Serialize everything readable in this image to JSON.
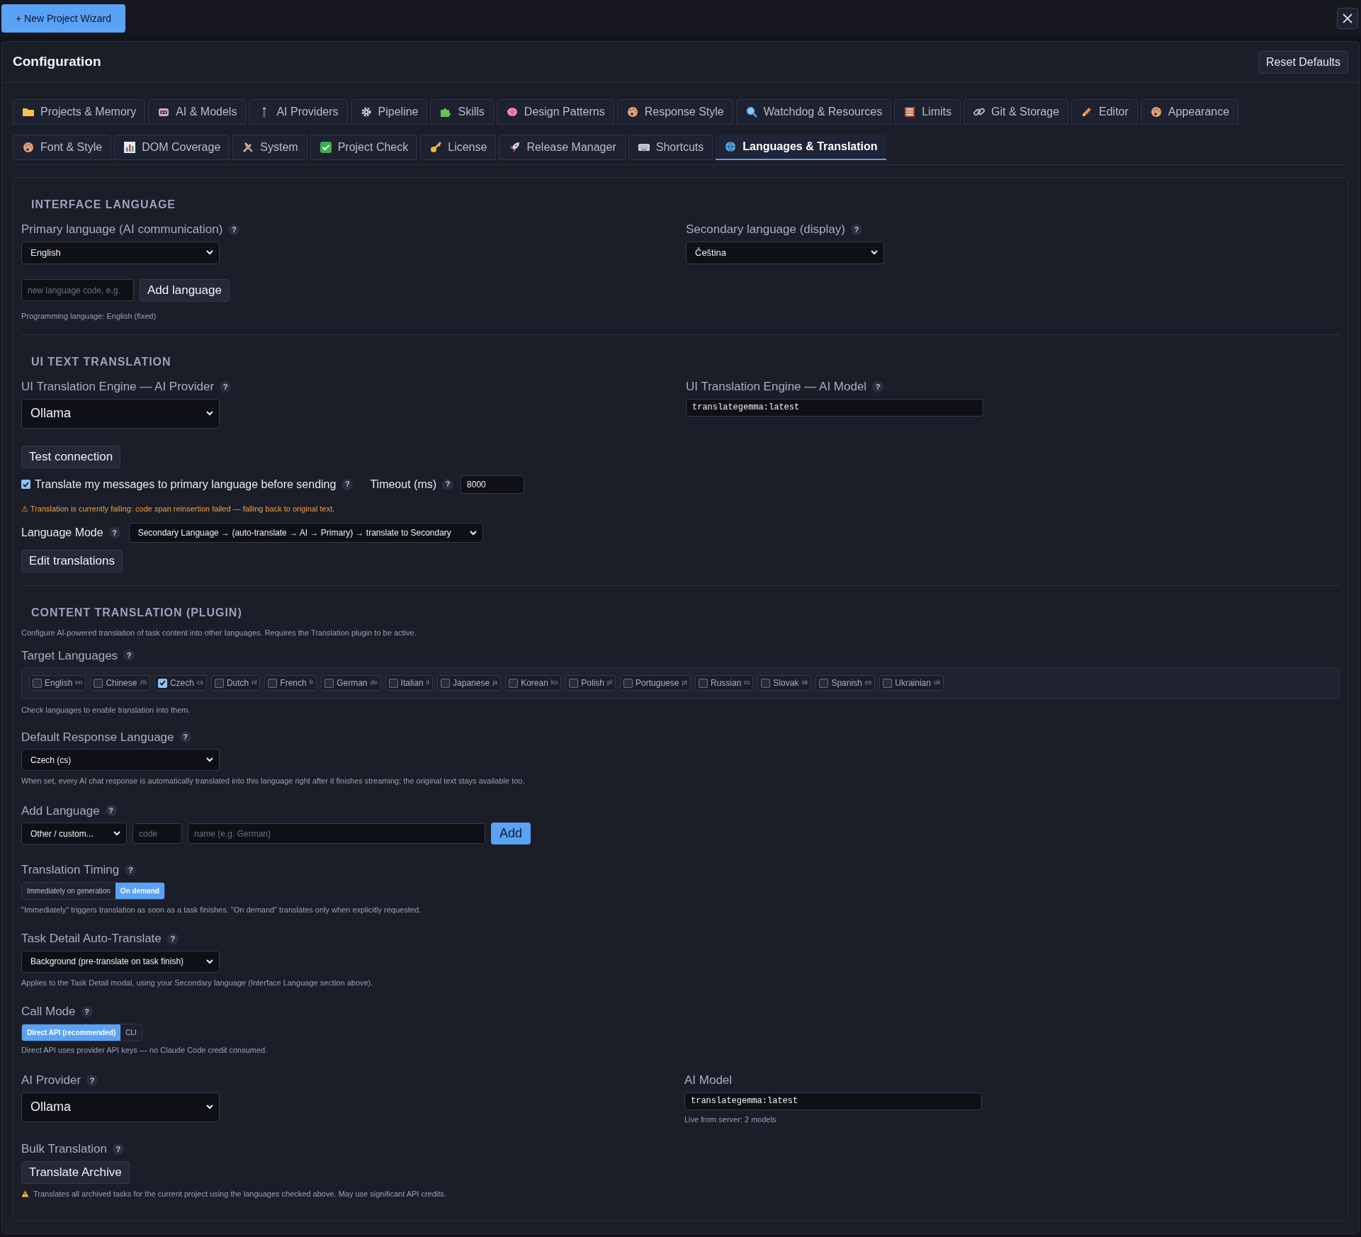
{
  "top_bar": {
    "new_project_button": "+ New Project Wizard"
  },
  "header": {
    "title": "Configuration",
    "reset_button": "Reset Defaults"
  },
  "tab_rows": [
    [
      {
        "label": "Projects & Memory",
        "selected": false
      },
      {
        "label": "AI & Models",
        "selected": false
      },
      {
        "label": "AI Providers",
        "selected": false
      },
      {
        "label": "Pipeline",
        "selected": false
      },
      {
        "label": "Skills",
        "selected": false
      },
      {
        "label": "Design Patterns",
        "selected": false
      },
      {
        "label": "Response Style",
        "selected": false
      },
      {
        "label": "Watchdog & Resources",
        "selected": false
      },
      {
        "label": "Limits",
        "selected": false
      },
      {
        "label": "Git & Storage",
        "selected": false
      },
      {
        "label": "Editor",
        "selected": false
      },
      {
        "label": "Appearance",
        "selected": false
      }
    ],
    [
      {
        "label": "Font & Style",
        "selected": false
      },
      {
        "label": "DOM Coverage",
        "selected": false
      },
      {
        "label": "System",
        "selected": false
      },
      {
        "label": "Project Check",
        "selected": false
      },
      {
        "label": "License",
        "selected": false
      },
      {
        "label": "Release Manager",
        "selected": false
      },
      {
        "label": "Shortcuts",
        "selected": false
      },
      {
        "label": "Languages & Translation",
        "selected": true
      }
    ]
  ],
  "interface_language": {
    "heading": "INTERFACE LANGUAGE",
    "primary": {
      "label": "Primary language (AI communication)",
      "help": "?",
      "value": "English"
    },
    "secondary": {
      "label": "Secondary language (display)",
      "help": "?",
      "value": "Čeština"
    },
    "new_language": {
      "placeholder": "new language code, e.g.",
      "button": "Add language"
    },
    "note": "Programming language: English (fixed)"
  },
  "ui_text_translation": {
    "heading": "UI TEXT TRANSLATION",
    "provider": {
      "label": "UI Translation Engine — AI Provider",
      "help": "?",
      "value": "Ollama"
    },
    "model": {
      "label": "UI Translation Engine — AI Model",
      "help": "?",
      "value": "translategemma:latest"
    },
    "test_button": "Test connection",
    "translate_messages": {
      "label": "Translate my messages to primary language before sending",
      "help": "?",
      "checked": true
    },
    "timeout": {
      "label": "Timeout (ms)",
      "help": "?",
      "value": "8000"
    },
    "warning": "⚠ Translation is currently failing: code span reinsertion failed — falling back to original text.",
    "language_mode": {
      "label": "Language Mode",
      "help": "?",
      "value": "Secondary Language → (auto-translate → AI → Primary) → translate to Secondary"
    },
    "edit_button": "Edit translations"
  },
  "content_translation": {
    "heading": "CONTENT TRANSLATION (PLUGIN)",
    "description": "Configure AI-powered translation of task content into other languages. Requires the Translation plugin to be active.",
    "target_languages": {
      "label": "Target Languages",
      "help": "?",
      "items": [
        {
          "label": "English",
          "code": "en",
          "checked": false
        },
        {
          "label": "Chinese",
          "code": "zh",
          "checked": false
        },
        {
          "label": "Czech",
          "code": "cs",
          "checked": true
        },
        {
          "label": "Dutch",
          "code": "nl",
          "checked": false
        },
        {
          "label": "French",
          "code": "fr",
          "checked": false
        },
        {
          "label": "German",
          "code": "de",
          "checked": false
        },
        {
          "label": "Italian",
          "code": "it",
          "checked": false
        },
        {
          "label": "Japanese",
          "code": "ja",
          "checked": false
        },
        {
          "label": "Korean",
          "code": "ko",
          "checked": false
        },
        {
          "label": "Polish",
          "code": "pl",
          "checked": false
        },
        {
          "label": "Portuguese",
          "code": "pt",
          "checked": false
        },
        {
          "label": "Russian",
          "code": "ru",
          "checked": false
        },
        {
          "label": "Slovak",
          "code": "sk",
          "checked": false
        },
        {
          "label": "Spanish",
          "code": "es",
          "checked": false
        },
        {
          "label": "Ukrainian",
          "code": "uk",
          "checked": false
        }
      ],
      "note": "Check languages to enable translation into them."
    },
    "default_response": {
      "label": "Default Response Language",
      "help": "?",
      "value": "Czech (cs)",
      "note": "When set, every AI chat response is automatically translated into this language right after it finishes streaming; the original text stays available too."
    },
    "add_language": {
      "label": "Add Language",
      "help": "?",
      "preset": "Other / custom...",
      "code_placeholder": "code",
      "name_placeholder": "name (e.g. German)",
      "button": "Add"
    },
    "timing": {
      "label": "Translation Timing",
      "help": "?",
      "options": [
        {
          "label": "Immediately on generation",
          "selected": false
        },
        {
          "label": "On demand",
          "selected": true
        }
      ],
      "note": "\"Immediately\" triggers translation as soon as a task finishes. \"On demand\" translates only when explicitly requested."
    },
    "task_detail": {
      "label": "Task Detail Auto-Translate",
      "help": "?",
      "value": "Background (pre-translate on task finish)",
      "note": "Applies to the Task Detail modal, using your Secondary language (Interface Language section above)."
    },
    "call_mode": {
      "label": "Call Mode",
      "help": "?",
      "options": [
        {
          "label": "Direct API (recommended)",
          "selected": true
        },
        {
          "label": "CLI",
          "selected": false
        }
      ],
      "note": "Direct API uses provider API keys — no Claude Code credit consumed."
    },
    "ai_provider": {
      "label": "AI Provider",
      "help": "?",
      "value": "Ollama"
    },
    "ai_model": {
      "label": "AI Model",
      "value": "translategemma:latest",
      "note": "Live from server: 2 models"
    },
    "bulk": {
      "label": "Bulk Translation",
      "help": "?",
      "button": "Translate Archive",
      "note": "Translates all archived tasks for the current project using the languages checked above. May use significant API credits."
    }
  }
}
